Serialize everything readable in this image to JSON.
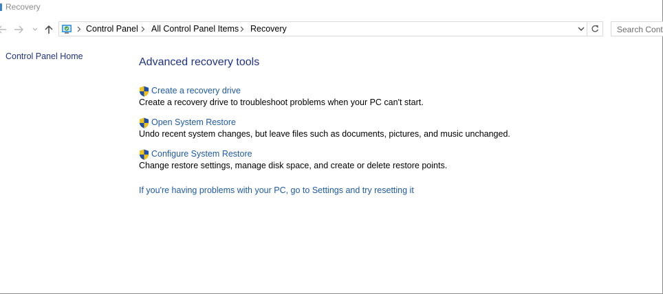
{
  "window": {
    "title": "Recovery"
  },
  "navigation": {
    "breadcrumbs": [
      "Control Panel",
      "All Control Panel Items",
      "Recovery"
    ]
  },
  "search": {
    "placeholder": "Search Control Panel"
  },
  "sidebar": {
    "home_link": "Control Panel Home"
  },
  "main": {
    "heading": "Advanced recovery tools",
    "tools": [
      {
        "label": "Create a recovery drive",
        "description": "Create a recovery drive to troubleshoot problems when your PC can't start."
      },
      {
        "label": "Open System Restore",
        "description": "Undo recent system changes, but leave files such as documents, pictures, and music unchanged."
      },
      {
        "label": "Configure System Restore",
        "description": "Change restore settings, manage disk space, and create or delete restore points."
      }
    ],
    "reset_link": "If you're having problems with your PC, go to Settings and try resetting it"
  },
  "colors": {
    "link": "#1e5aa8",
    "heading": "#1e3287",
    "shield_blue": "#1f4fa8",
    "shield_yellow": "#f2c21a"
  },
  "icons": [
    "back-arrow-icon",
    "forward-arrow-icon",
    "recent-dropdown-icon",
    "up-arrow-icon",
    "control-panel-icon",
    "chevron-right-icon",
    "chevron-down-icon",
    "refresh-icon",
    "uac-shield-icon"
  ]
}
